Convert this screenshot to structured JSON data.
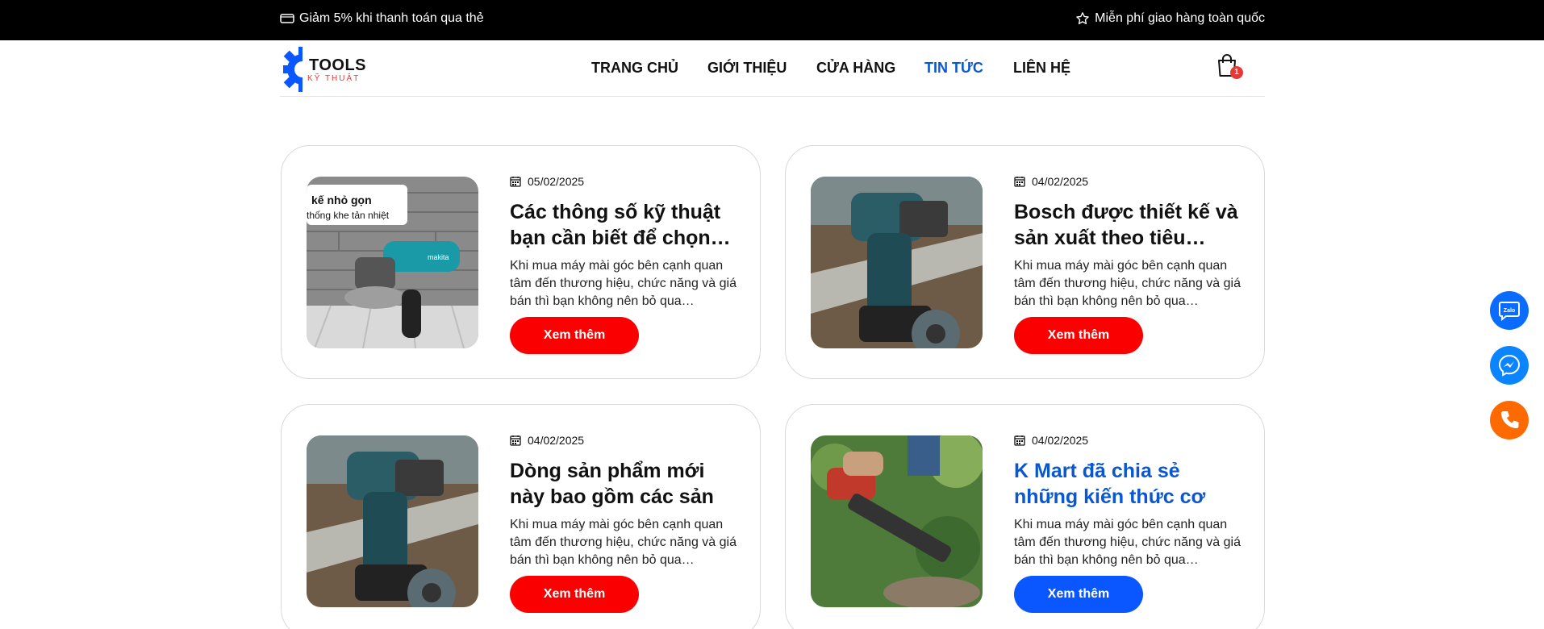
{
  "topbar": {
    "left_text": "Giảm 5% khi thanh toán qua thẻ",
    "right_text": "Miễn phí giao hàng toàn quốc",
    "left_icon": "card-icon",
    "right_icon": "star-icon"
  },
  "logo": {
    "title": "TOOLS",
    "subtitle": "KỸ THUẬT",
    "gear_color": "#0b57ff"
  },
  "nav": {
    "items": [
      {
        "label": "TRANG CHỦ"
      },
      {
        "label": "GIỚI THIỆU"
      },
      {
        "label": "CỬA HÀNG"
      },
      {
        "label": "TIN TỨC",
        "active": true
      },
      {
        "label": "LIÊN HỆ"
      }
    ],
    "active_color": "#0b57d0"
  },
  "cart": {
    "count": "1",
    "icon": "shopping-bag-icon"
  },
  "posts": [
    {
      "date": "05/02/2025",
      "title": "Các thông số kỹ thuật bạn cần biết để chọn…",
      "excerpt": "Khi mua máy mài góc bên cạnh quan tâm đến thương hiệu, chức năng và giá bán thì bạn không nên bỏ qua…",
      "button": "Xem thêm",
      "image_caption_1": "kế nhỏ gọn",
      "image_caption_2": "thống khe tản nhiệt",
      "image_brand": "makita"
    },
    {
      "date": "04/02/2025",
      "title": "Bosch được thiết kế và sản xuất theo tiêu…",
      "excerpt": "Khi mua máy mài góc bên cạnh quan tâm đến thương hiệu, chức năng và giá bán thì bạn không nên bỏ qua…",
      "button": "Xem thêm"
    },
    {
      "date": "04/02/2025",
      "title": "Dòng sản phẩm mới này bao gồm các sản phẩ…",
      "excerpt": "Khi mua máy mài góc bên cạnh quan tâm đến thương hiệu, chức năng và giá bán thì bạn không nên bỏ qua…",
      "button": "Xem thêm"
    },
    {
      "date": "04/02/2025",
      "title": "K Mart đã chia sẻ những kiến thức cơ bả…",
      "excerpt": "Khi mua máy mài góc bên cạnh quan tâm đến thương hiệu, chức năng và giá bán thì bạn không nên bỏ qua…",
      "button": "Xem thêm",
      "highlighted": true
    }
  ],
  "floating": {
    "zalo_label": "Zalo",
    "zalo_color": "#0a6cff",
    "messenger_color": "#0a84ff",
    "phone_color": "#ff6a00"
  },
  "colors": {
    "button_red": "#fa0000",
    "button_blue": "#0b57ff",
    "topbar_bg": "#000000"
  }
}
